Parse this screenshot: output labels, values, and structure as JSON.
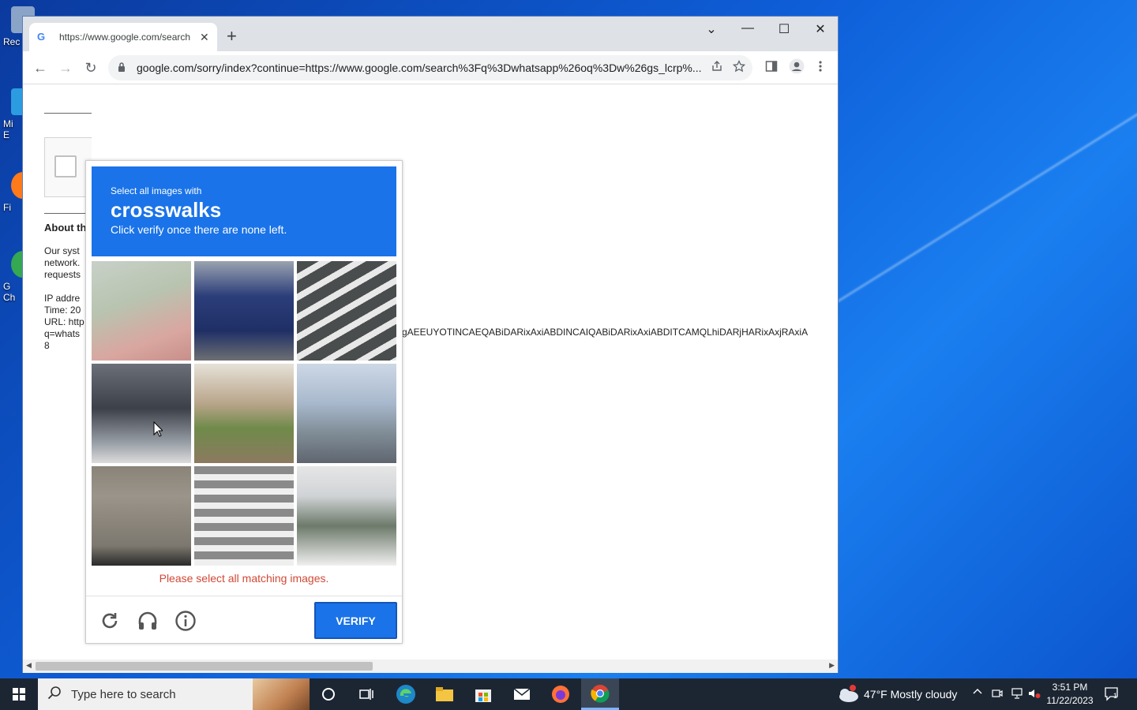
{
  "desktop": {
    "icons": [
      {
        "label": "Rec",
        "color": "#8aa4c8"
      },
      {
        "label": "Mi\nE",
        "color": "#2b9ce0"
      },
      {
        "label": "Fi",
        "color": "#ff7a1a"
      },
      {
        "label": "G\nCh",
        "color": "#34a853"
      }
    ]
  },
  "browser": {
    "tab": {
      "favicon": "G",
      "title": "https://www.google.com/search",
      "close": "✕"
    },
    "new_tab": "+",
    "window_controls": {
      "tab_search": "⌄",
      "minimize": "—",
      "maximize": "☐",
      "close": "✕"
    },
    "nav": {
      "back": "←",
      "forward": "→",
      "reload": "↻"
    },
    "address": {
      "url": "google.com/sorry/index?continue=https://www.google.com/search%3Fq%3Dwhatsapp%26oq%3Dw%26gs_lcrp%..."
    },
    "page": {
      "about_heading": "About th",
      "lines1": [
        "Our syst",
        "network.",
        "requests"
      ],
      "lines2": [
        "IP addre",
        "Time: 20",
        "URL: http",
        "q=whats",
        "8"
      ],
      "long_string": "gAEEUYOTINCAEQABiDARixAxiABDINCAIQABiDARixAxiABDITCAMQLhiDARjHARixAxjRAxiA"
    }
  },
  "captcha": {
    "header_small": "Select all images with",
    "header_target": "crosswalks",
    "header_instruction": "Click verify once there are none left.",
    "tiles": [
      {
        "id": "stairs-planter",
        "bg": "linear-gradient(160deg,#c8d0c8 0%,#b8c4b0 40%,#d9a6a0 75%,#c88f8a 100%)"
      },
      {
        "id": "blue-truck",
        "bg": "linear-gradient(180deg,#9aa3b0 0%,#2c3e7a 35%,#1f2f66 70%,#6d6f72 100%)"
      },
      {
        "id": "crosswalk-road",
        "bg": "repeating-linear-gradient(150deg,#4a4d4d 0px,#4a4d4d 14px,#e8e8e8 14px,#e8e8e8 22px)"
      },
      {
        "id": "bike-bus-stop",
        "bg": "linear-gradient(180deg,#6b6f78 0%,#3c4048 45%,#9aa0a8 80%,#dcdcdc 100%)"
      },
      {
        "id": "hillside-houses",
        "bg": "linear-gradient(180deg,#e6e2d9 0%,#b9a58a 40%,#6f8a4a 65%,#8c7a5f 100%)"
      },
      {
        "id": "city-intersection",
        "bg": "linear-gradient(180deg,#cdd8e6 0%,#a8b8cc 40%,#7f8c96 70%,#5f6670 100%)"
      },
      {
        "id": "road-crosswalk-grey",
        "bg": "linear-gradient(180deg,#8a8378 0%,#9a948a 30%,#7d786f 80%,#2a2a2a 100%)"
      },
      {
        "id": "pedestrian-crosswalk",
        "bg": "repeating-linear-gradient(180deg,#8a8a8a 0px,#8a8a8a 10px,#efefef 10px,#efefef 18px)"
      },
      {
        "id": "bikes-parked-cars",
        "bg": "linear-gradient(180deg,#e6e6e6 0%,#d0d3d6 30%,#6d7a6a 60%,#f0f0f0 100%)"
      }
    ],
    "error": "Please select all matching images.",
    "verify_label": "VERIFY"
  },
  "taskbar": {
    "search_placeholder": "Type here to search",
    "weather": "47°F  Mostly cloudy",
    "time": "3:51 PM",
    "date": "11/22/2023",
    "notification_count": "1"
  }
}
